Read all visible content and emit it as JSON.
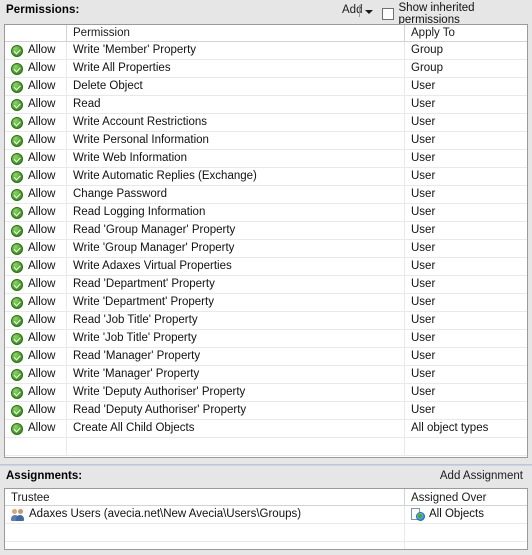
{
  "permissions": {
    "label": "Permissions:",
    "add_label": "Add",
    "dropdown_icon": "chevron-down-icon",
    "show_inherited_label": "Show inherited permissions",
    "show_inherited_checked": false,
    "columns": [
      "",
      "Permission",
      "Apply To"
    ],
    "rows": [
      {
        "access": "Allow",
        "icon": "allow-check-icon",
        "permission": "Write 'Member' Property",
        "apply_to": "Group"
      },
      {
        "access": "Allow",
        "icon": "allow-check-icon",
        "permission": "Write All Properties",
        "apply_to": "Group"
      },
      {
        "access": "Allow",
        "icon": "allow-check-icon",
        "permission": "Delete Object",
        "apply_to": "User"
      },
      {
        "access": "Allow",
        "icon": "allow-check-icon",
        "permission": "Read",
        "apply_to": "User"
      },
      {
        "access": "Allow",
        "icon": "allow-check-icon",
        "permission": "Write Account Restrictions",
        "apply_to": "User"
      },
      {
        "access": "Allow",
        "icon": "allow-check-icon",
        "permission": "Write Personal Information",
        "apply_to": "User"
      },
      {
        "access": "Allow",
        "icon": "allow-check-icon",
        "permission": "Write Web Information",
        "apply_to": "User"
      },
      {
        "access": "Allow",
        "icon": "allow-check-icon",
        "permission": "Write Automatic Replies (Exchange)",
        "apply_to": "User"
      },
      {
        "access": "Allow",
        "icon": "allow-check-icon",
        "permission": "Change Password",
        "apply_to": "User"
      },
      {
        "access": "Allow",
        "icon": "allow-check-icon",
        "permission": "Read Logging Information",
        "apply_to": "User"
      },
      {
        "access": "Allow",
        "icon": "allow-check-icon",
        "permission": "Read 'Group Manager' Property",
        "apply_to": "User"
      },
      {
        "access": "Allow",
        "icon": "allow-check-icon",
        "permission": "Write 'Group Manager' Property",
        "apply_to": "User"
      },
      {
        "access": "Allow",
        "icon": "allow-check-icon",
        "permission": "Write Adaxes Virtual Properties",
        "apply_to": "User"
      },
      {
        "access": "Allow",
        "icon": "allow-check-icon",
        "permission": "Read 'Department' Property",
        "apply_to": "User"
      },
      {
        "access": "Allow",
        "icon": "allow-check-icon",
        "permission": "Write 'Department' Property",
        "apply_to": "User"
      },
      {
        "access": "Allow",
        "icon": "allow-check-icon",
        "permission": "Read 'Job Title' Property",
        "apply_to": "User"
      },
      {
        "access": "Allow",
        "icon": "allow-check-icon",
        "permission": "Write 'Job Title' Property",
        "apply_to": "User"
      },
      {
        "access": "Allow",
        "icon": "allow-check-icon",
        "permission": "Read 'Manager' Property",
        "apply_to": "User"
      },
      {
        "access": "Allow",
        "icon": "allow-check-icon",
        "permission": "Write 'Manager' Property",
        "apply_to": "User"
      },
      {
        "access": "Allow",
        "icon": "allow-check-icon",
        "permission": "Write 'Deputy Authoriser' Property",
        "apply_to": "User"
      },
      {
        "access": "Allow",
        "icon": "allow-check-icon",
        "permission": "Read 'Deputy Authoriser' Property",
        "apply_to": "User"
      },
      {
        "access": "Allow",
        "icon": "allow-check-icon",
        "permission": "Create All Child Objects",
        "apply_to": "All object types"
      }
    ],
    "empty_row_count": 1
  },
  "assignments": {
    "label": "Assignments:",
    "add_label": "Add Assignment",
    "columns": [
      "Trustee",
      "Assigned Over"
    ],
    "rows": [
      {
        "trustee": "Adaxes Users (avecia.net\\New Avecia\\Users\\Groups)",
        "trustee_icon": "group-users-icon",
        "assigned_over": "All Objects",
        "assigned_over_icon": "all-objects-icon"
      }
    ],
    "empty_row_count": 2
  },
  "colors": {
    "background": "#e6e6e6",
    "grid_background": "#ffffff",
    "grid_border": "#9a9a9a",
    "row_border": "#e9e9e9",
    "allow_green": "#4aa62a",
    "divider": "#c8d3e4"
  }
}
